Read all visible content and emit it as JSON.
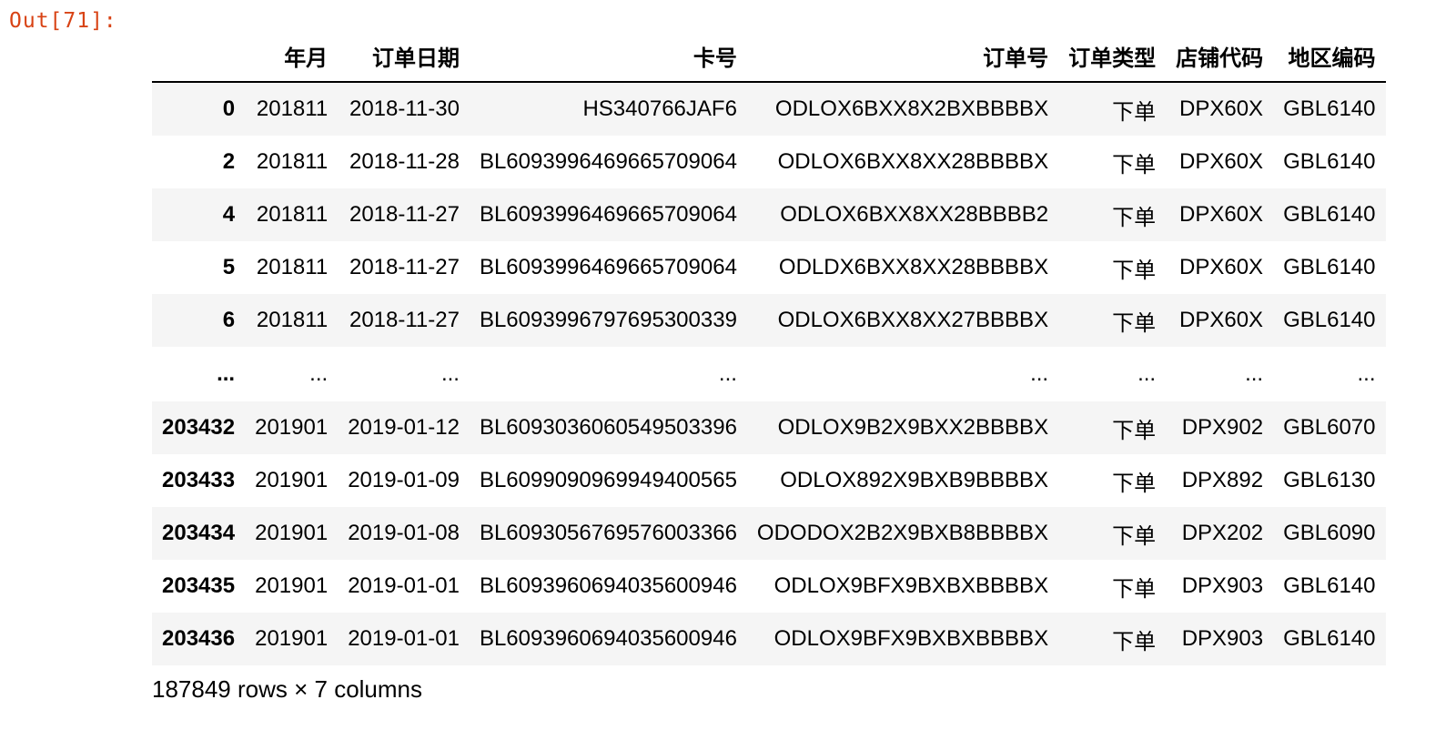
{
  "cell": {
    "prompt": "Out[71]:"
  },
  "table": {
    "index_header": "",
    "columns": [
      "年月",
      "订单日期",
      "卡号",
      "订单号",
      "订单类型",
      "店铺代码",
      "地区编码"
    ],
    "rows": [
      {
        "index": "0",
        "cells": [
          "201811",
          "2018-11-30",
          "HS340766JAF6",
          "ODLOX6BXX8X2BXBBBBX",
          "下单",
          "DPX60X",
          "GBL6140"
        ]
      },
      {
        "index": "2",
        "cells": [
          "201811",
          "2018-11-28",
          "BL6093996469665709064",
          "ODLOX6BXX8XX28BBBBX",
          "下单",
          "DPX60X",
          "GBL6140"
        ]
      },
      {
        "index": "4",
        "cells": [
          "201811",
          "2018-11-27",
          "BL6093996469665709064",
          "ODLOX6BXX8XX28BBBB2",
          "下单",
          "DPX60X",
          "GBL6140"
        ]
      },
      {
        "index": "5",
        "cells": [
          "201811",
          "2018-11-27",
          "BL6093996469665709064",
          "ODLDX6BXX8XX28BBBBX",
          "下单",
          "DPX60X",
          "GBL6140"
        ]
      },
      {
        "index": "6",
        "cells": [
          "201811",
          "2018-11-27",
          "BL6093996797695300339",
          "ODLOX6BXX8XX27BBBBX",
          "下单",
          "DPX60X",
          "GBL6140"
        ]
      },
      {
        "index": "...",
        "cells": [
          "...",
          "...",
          "...",
          "...",
          "...",
          "...",
          "..."
        ]
      },
      {
        "index": "203432",
        "cells": [
          "201901",
          "2019-01-12",
          "BL6093036060549503396",
          "ODLOX9B2X9BXX2BBBBX",
          "下单",
          "DPX902",
          "GBL6070"
        ]
      },
      {
        "index": "203433",
        "cells": [
          "201901",
          "2019-01-09",
          "BL6099090969949400565",
          "ODLOX892X9BXB9BBBBX",
          "下单",
          "DPX892",
          "GBL6130"
        ]
      },
      {
        "index": "203434",
        "cells": [
          "201901",
          "2019-01-08",
          "BL6093056769576003366",
          "ODODOX2B2X9BXB8BBBBX",
          "下单",
          "DPX202",
          "GBL6090"
        ]
      },
      {
        "index": "203435",
        "cells": [
          "201901",
          "2019-01-01",
          "BL6093960694035600946",
          "ODLOX9BFX9BXBXBBBBX",
          "下单",
          "DPX903",
          "GBL6140"
        ]
      },
      {
        "index": "203436",
        "cells": [
          "201901",
          "2019-01-01",
          "BL6093960694035600946",
          "ODLOX9BFX9BXBXBBBBX",
          "下单",
          "DPX903",
          "GBL6140"
        ]
      }
    ],
    "footer": "187849 rows × 7 columns"
  },
  "colors": {
    "prompt": "#d84315",
    "row_stripe": "#f5f5f5",
    "header_rule": "#000000"
  }
}
